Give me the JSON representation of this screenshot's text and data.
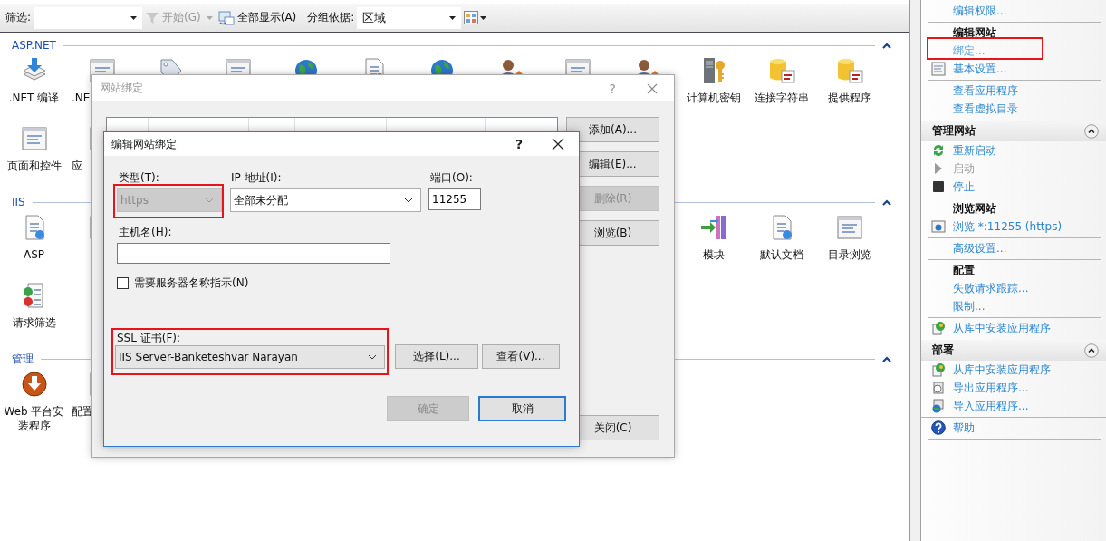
{
  "toolbar": {
    "filter_label": "筛选:",
    "start_button": {
      "label": "开始(G)",
      "disabled": true
    },
    "show_all_button": "全部显示(A)",
    "group_by_label": "分组依据:",
    "group_by_value": "区域"
  },
  "groups": [
    {
      "title": "ASP.NET",
      "rows": [
        [
          {
            "kind": "tile",
            "label": ".NET 编译"
          },
          {
            "kind": "tile",
            "label": ".NE"
          },
          {
            "kind": "tile"
          },
          {
            "kind": "tile"
          },
          {
            "kind": "tile"
          },
          {
            "kind": "tile"
          },
          {
            "kind": "tile"
          },
          {
            "kind": "tile"
          },
          {
            "kind": "tile"
          },
          {
            "kind": "tile"
          },
          {
            "kind": "tile",
            "label": "计算机密钥"
          },
          {
            "kind": "tile",
            "label": "连接字符串"
          },
          {
            "kind": "tile",
            "label": "提供程序"
          }
        ],
        [
          {
            "kind": "tile",
            "label": "页面和控件"
          },
          {
            "kind": "tile",
            "label": "应"
          }
        ]
      ]
    },
    {
      "title": "IIS",
      "rows": [
        [
          {
            "kind": "tile",
            "label": "ASP"
          },
          {
            "kind": "tile"
          },
          {
            "kind": "tile",
            "label": "模块"
          },
          {
            "kind": "tile",
            "label": "默认文档"
          },
          {
            "kind": "tile",
            "label": "目录浏览"
          }
        ],
        [
          {
            "kind": "tile",
            "label": "请求筛选"
          }
        ]
      ]
    },
    {
      "title": "管理",
      "rows": [
        [
          {
            "kind": "tile",
            "label": "Web 平台安装程序"
          },
          {
            "kind": "tile",
            "label": "配置"
          }
        ]
      ]
    }
  ],
  "actions": [
    {
      "items": [
        {
          "label": "编辑权限...",
          "disabled": false,
          "highlighted": false
        }
      ]
    },
    {
      "heading": "编辑网站",
      "items": [
        {
          "label": "绑定...",
          "disabled": false,
          "highlighted": true
        },
        {
          "label": "基本设置...",
          "disabled": false,
          "highlighted": false
        }
      ]
    },
    {
      "items": [
        {
          "label": "查看应用程序",
          "disabled": false,
          "highlighted": false
        },
        {
          "label": "查看虚拟目录",
          "disabled": false,
          "highlighted": false
        }
      ]
    },
    {
      "section": "管理网站",
      "items": [
        {
          "label": "重新启动",
          "disabled": false,
          "highlighted": false
        },
        {
          "label": "启动",
          "disabled": true,
          "highlighted": false
        },
        {
          "label": "停止",
          "disabled": false,
          "highlighted": false
        }
      ]
    },
    {
      "heading": "浏览网站",
      "items": [
        {
          "label": "浏览 *:11255 (https)",
          "disabled": false,
          "highlighted": false
        }
      ]
    },
    {
      "items": [
        {
          "label": "高级设置...",
          "disabled": false,
          "highlighted": false
        }
      ]
    },
    {
      "heading": "配置",
      "items": [
        {
          "label": "失败请求跟踪...",
          "disabled": false,
          "highlighted": false
        },
        {
          "label": "限制...",
          "disabled": false,
          "highlighted": false
        }
      ]
    },
    {
      "items": [
        {
          "label": "从库中安装应用程序",
          "disabled": false,
          "highlighted": false
        }
      ]
    },
    {
      "section": "部署",
      "items": [
        {
          "label": "从库中安装应用程序",
          "disabled": false,
          "highlighted": false
        },
        {
          "label": "导出应用程序...",
          "disabled": false,
          "highlighted": false
        },
        {
          "label": "导入应用程序...",
          "disabled": false,
          "highlighted": false
        }
      ]
    },
    {
      "items": [
        {
          "label": "帮助",
          "disabled": false,
          "highlighted": false
        }
      ]
    }
  ],
  "bindings_dialog": {
    "title": "网站绑定",
    "help": "?",
    "buttons": [
      {
        "label": "添加(A)...",
        "disabled": false
      },
      {
        "label": "编辑(E)...",
        "disabled": false
      },
      {
        "label": "删除(R)",
        "disabled": true
      },
      {
        "label": "浏览(B)",
        "disabled": false
      }
    ],
    "close_button": "关闭(C)"
  },
  "edit_dialog": {
    "title": "编辑网站绑定",
    "help": "?",
    "type": {
      "label": "类型(T):",
      "value": "https",
      "disabled": true,
      "highlighted": true
    },
    "ip": {
      "label": "IP 地址(I):",
      "value": "全部未分配"
    },
    "port": {
      "label": "端口(O):",
      "value": "11255"
    },
    "host": {
      "label": "主机名(H):"
    },
    "sni": {
      "label": "需要服务器名称指示(N)",
      "checked": false
    },
    "ssl": {
      "label": "SSL 证书(F):",
      "value": "IIS Server-Banketeshvar Narayan",
      "highlighted": true
    },
    "select_button": "选择(L)...",
    "view_button": "查看(V)...",
    "ok_button": {
      "label": "确定",
      "disabled": true
    },
    "cancel_button": {
      "label": "取消",
      "default": true
    }
  }
}
